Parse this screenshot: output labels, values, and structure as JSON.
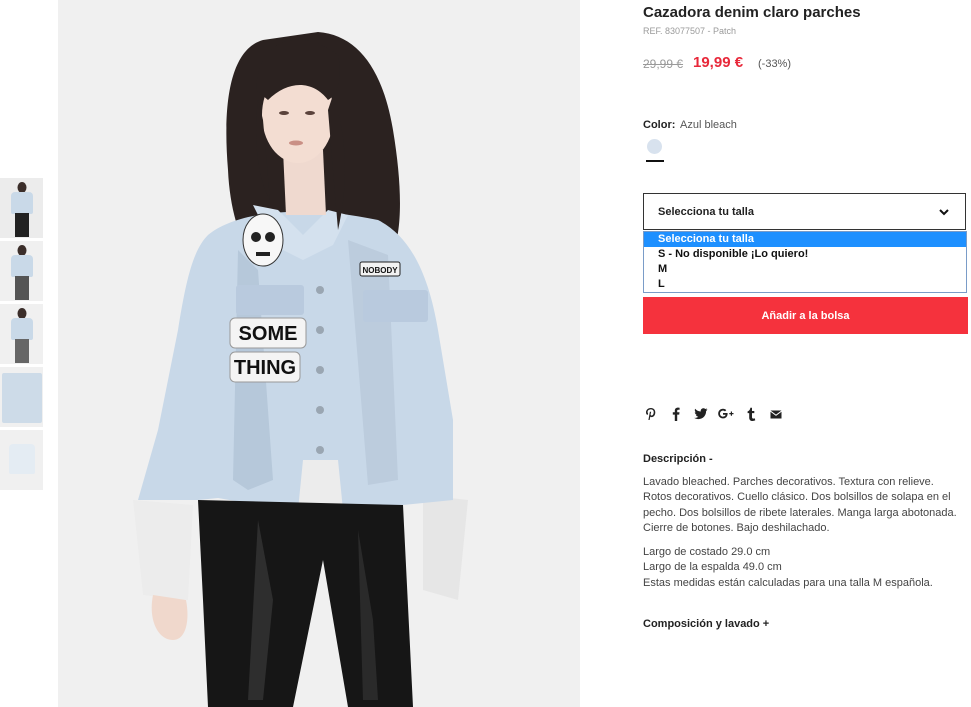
{
  "product": {
    "title": "Cazadora denim claro parches",
    "ref": "REF. 83077507 - Patch",
    "old_price": "29,99 €",
    "new_price": "19,99 €",
    "discount": "(-33%)"
  },
  "photo": {
    "patch_word_1": "SOME",
    "patch_word_2": "THING",
    "badge_text": "NOBODY"
  },
  "color": {
    "label": "Color:",
    "value": "Azul bleach",
    "swatch_color": "#d8e2ee"
  },
  "size": {
    "placeholder": "Selecciona tu talla",
    "options": [
      "Selecciona tu talla",
      "S - No disponible ¡Lo quiero!",
      "M",
      "L"
    ]
  },
  "add_to_bag": "Añadir a la bolsa",
  "social": {
    "icons": [
      "pinterest-icon",
      "facebook-icon",
      "twitter-icon",
      "google-plus-icon",
      "tumblr-icon",
      "email-icon"
    ]
  },
  "description": {
    "title": "Descripción  -",
    "text": "Lavado bleached. Parches decorativos. Textura con relieve. Rotos decorativos. Cuello clásico. Dos bolsillos de solapa en el pecho. Dos bolsillos de ribete laterales. Manga larga abotonada. Cierre de botones. Bajo deshilachado.",
    "measure_1": "Largo de costado 29.0 cm",
    "measure_2": "Largo de la espalda 49.0 cm",
    "measure_note": "Estas medidas están calculadas para una talla M española."
  },
  "composition": {
    "title": "Composición y lavado  +"
  },
  "colors": {
    "accent_red": "#f5323d",
    "price_red": "#e8283a",
    "select_highlight": "#1e90ff"
  }
}
